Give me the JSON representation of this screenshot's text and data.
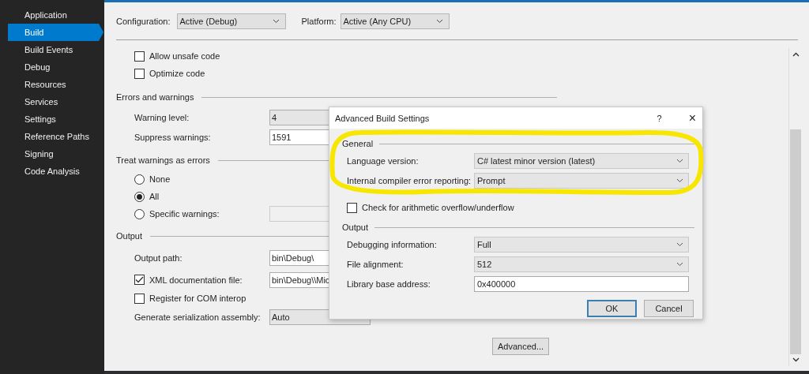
{
  "sidebar": {
    "items": [
      {
        "label": "Application",
        "selected": false
      },
      {
        "label": "Build",
        "selected": true
      },
      {
        "label": "Build Events",
        "selected": false
      },
      {
        "label": "Debug",
        "selected": false
      },
      {
        "label": "Resources",
        "selected": false
      },
      {
        "label": "Services",
        "selected": false
      },
      {
        "label": "Settings",
        "selected": false
      },
      {
        "label": "Reference Paths",
        "selected": false
      },
      {
        "label": "Signing",
        "selected": false
      },
      {
        "label": "Code Analysis",
        "selected": false
      }
    ]
  },
  "toolbar": {
    "configuration": {
      "label": "Configuration:",
      "value": "Active (Debug)"
    },
    "platform": {
      "label": "Platform:",
      "value": "Active (Any CPU)"
    }
  },
  "general": {
    "checkboxes": [
      {
        "label": "Allow unsafe code",
        "checked": false
      },
      {
        "label": "Optimize code",
        "checked": false
      }
    ]
  },
  "errors": {
    "title": "Errors and warnings",
    "warning_level": {
      "label": "Warning level:",
      "value": "4"
    },
    "suppress": {
      "label": "Suppress warnings:",
      "value": "1591"
    }
  },
  "treat": {
    "title": "Treat warnings as errors",
    "options": [
      {
        "label": "None",
        "selected": false
      },
      {
        "label": "All",
        "selected": true
      },
      {
        "label": "Specific warnings:",
        "selected": false
      }
    ]
  },
  "output": {
    "title": "Output",
    "output_path": {
      "label": "Output path:",
      "value": "bin\\Debug\\"
    },
    "xml_doc": {
      "label": "XML documentation file:",
      "checked": true,
      "value": "bin\\Debug\\\\Mic"
    },
    "com_interop": {
      "label": "Register for COM interop",
      "checked": false
    },
    "serialization": {
      "label": "Generate serialization assembly:",
      "value": "Auto"
    }
  },
  "advanced_button": "Advanced...",
  "dialog": {
    "title": "Advanced Build Settings",
    "help": "?",
    "close": "×",
    "general": {
      "title": "General",
      "rows": [
        {
          "label": "Language version:",
          "value": "C# latest minor version (latest)"
        },
        {
          "label": "Internal compiler error reporting:",
          "value": "Prompt"
        }
      ],
      "overflow": {
        "label": "Check for arithmetic overflow/underflow",
        "checked": false
      }
    },
    "output": {
      "title": "Output",
      "rows": [
        {
          "kind": "combo",
          "label": "Debugging information:",
          "value": "Full"
        },
        {
          "kind": "combo",
          "label": "File alignment:",
          "value": "512"
        },
        {
          "kind": "text",
          "label": "Library base address:",
          "value": "0x400000"
        }
      ]
    },
    "buttons": [
      {
        "label": "OK",
        "default": true
      },
      {
        "label": "Cancel",
        "default": false
      }
    ]
  }
}
